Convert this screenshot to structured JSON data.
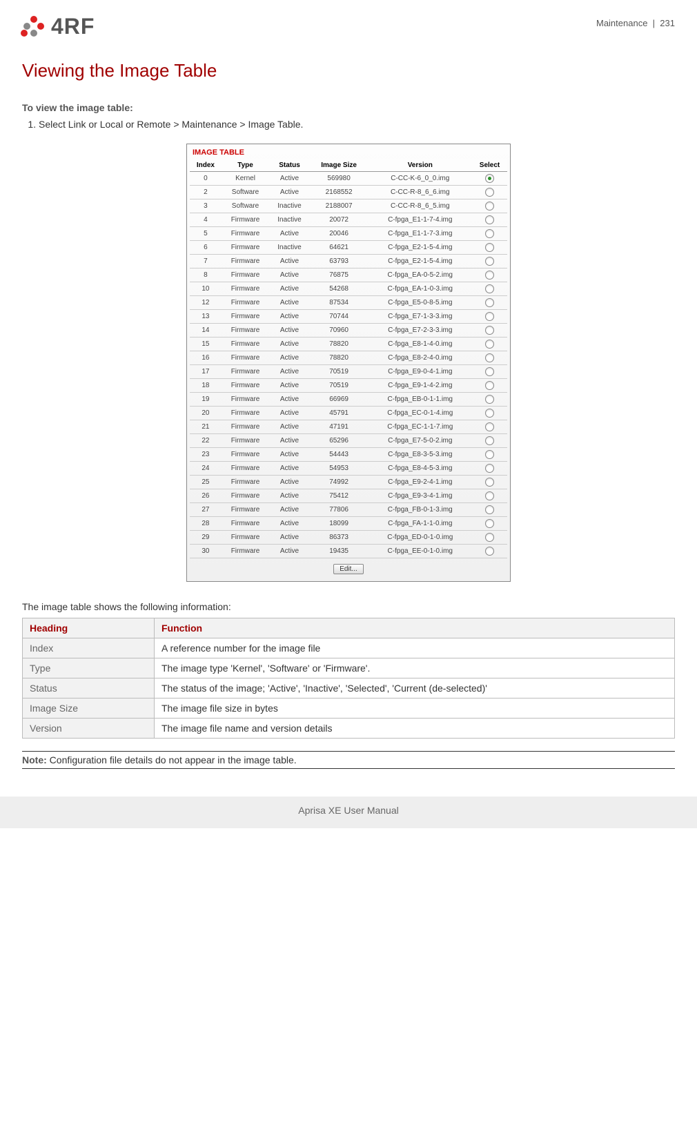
{
  "header": {
    "logo_text": "4RF",
    "section": "Maintenance",
    "separator": "|",
    "page_num": "231"
  },
  "title": "Viewing the Image Table",
  "intro": "To view the image table:",
  "step_number": "1.",
  "step_text": "Select Link or Local or Remote > Maintenance > Image Table.",
  "screenshot": {
    "panel_title": "IMAGE TABLE",
    "headers": [
      "Index",
      "Type",
      "Status",
      "Image Size",
      "Version",
      "Select"
    ],
    "rows": [
      {
        "index": "0",
        "type": "Kernel",
        "status": "Active",
        "size": "569980",
        "version": "C-CC-K-6_0_0.img",
        "selected": true
      },
      {
        "index": "2",
        "type": "Software",
        "status": "Active",
        "size": "2168552",
        "version": "C-CC-R-8_6_6.img",
        "selected": false
      },
      {
        "index": "3",
        "type": "Software",
        "status": "Inactive",
        "size": "2188007",
        "version": "C-CC-R-8_6_5.img",
        "selected": false
      },
      {
        "index": "4",
        "type": "Firmware",
        "status": "Inactive",
        "size": "20072",
        "version": "C-fpga_E1-1-7-4.img",
        "selected": false
      },
      {
        "index": "5",
        "type": "Firmware",
        "status": "Active",
        "size": "20046",
        "version": "C-fpga_E1-1-7-3.img",
        "selected": false
      },
      {
        "index": "6",
        "type": "Firmware",
        "status": "Inactive",
        "size": "64621",
        "version": "C-fpga_E2-1-5-4.img",
        "selected": false
      },
      {
        "index": "7",
        "type": "Firmware",
        "status": "Active",
        "size": "63793",
        "version": "C-fpga_E2-1-5-4.img",
        "selected": false
      },
      {
        "index": "8",
        "type": "Firmware",
        "status": "Active",
        "size": "76875",
        "version": "C-fpga_EA-0-5-2.img",
        "selected": false
      },
      {
        "index": "10",
        "type": "Firmware",
        "status": "Active",
        "size": "54268",
        "version": "C-fpga_EA-1-0-3.img",
        "selected": false
      },
      {
        "index": "12",
        "type": "Firmware",
        "status": "Active",
        "size": "87534",
        "version": "C-fpga_E5-0-8-5.img",
        "selected": false
      },
      {
        "index": "13",
        "type": "Firmware",
        "status": "Active",
        "size": "70744",
        "version": "C-fpga_E7-1-3-3.img",
        "selected": false
      },
      {
        "index": "14",
        "type": "Firmware",
        "status": "Active",
        "size": "70960",
        "version": "C-fpga_E7-2-3-3.img",
        "selected": false
      },
      {
        "index": "15",
        "type": "Firmware",
        "status": "Active",
        "size": "78820",
        "version": "C-fpga_E8-1-4-0.img",
        "selected": false
      },
      {
        "index": "16",
        "type": "Firmware",
        "status": "Active",
        "size": "78820",
        "version": "C-fpga_E8-2-4-0.img",
        "selected": false
      },
      {
        "index": "17",
        "type": "Firmware",
        "status": "Active",
        "size": "70519",
        "version": "C-fpga_E9-0-4-1.img",
        "selected": false
      },
      {
        "index": "18",
        "type": "Firmware",
        "status": "Active",
        "size": "70519",
        "version": "C-fpga_E9-1-4-2.img",
        "selected": false
      },
      {
        "index": "19",
        "type": "Firmware",
        "status": "Active",
        "size": "66969",
        "version": "C-fpga_EB-0-1-1.img",
        "selected": false
      },
      {
        "index": "20",
        "type": "Firmware",
        "status": "Active",
        "size": "45791",
        "version": "C-fpga_EC-0-1-4.img",
        "selected": false
      },
      {
        "index": "21",
        "type": "Firmware",
        "status": "Active",
        "size": "47191",
        "version": "C-fpga_EC-1-1-7.img",
        "selected": false
      },
      {
        "index": "22",
        "type": "Firmware",
        "status": "Active",
        "size": "65296",
        "version": "C-fpga_E7-5-0-2.img",
        "selected": false
      },
      {
        "index": "23",
        "type": "Firmware",
        "status": "Active",
        "size": "54443",
        "version": "C-fpga_E8-3-5-3.img",
        "selected": false
      },
      {
        "index": "24",
        "type": "Firmware",
        "status": "Active",
        "size": "54953",
        "version": "C-fpga_E8-4-5-3.img",
        "selected": false
      },
      {
        "index": "25",
        "type": "Firmware",
        "status": "Active",
        "size": "74992",
        "version": "C-fpga_E9-2-4-1.img",
        "selected": false
      },
      {
        "index": "26",
        "type": "Firmware",
        "status": "Active",
        "size": "75412",
        "version": "C-fpga_E9-3-4-1.img",
        "selected": false
      },
      {
        "index": "27",
        "type": "Firmware",
        "status": "Active",
        "size": "77806",
        "version": "C-fpga_FB-0-1-3.img",
        "selected": false
      },
      {
        "index": "28",
        "type": "Firmware",
        "status": "Active",
        "size": "18099",
        "version": "C-fpga_FA-1-1-0.img",
        "selected": false
      },
      {
        "index": "29",
        "type": "Firmware",
        "status": "Active",
        "size": "86373",
        "version": "C-fpga_ED-0-1-0.img",
        "selected": false
      },
      {
        "index": "30",
        "type": "Firmware",
        "status": "Active",
        "size": "19435",
        "version": "C-fpga_EE-0-1-0.img",
        "selected": false
      }
    ],
    "edit_label": "Edit..."
  },
  "desc_intro": "The image table shows the following information:",
  "desc_table": {
    "headers": [
      "Heading",
      "Function"
    ],
    "rows": [
      {
        "h": "Index",
        "f": "A reference number for the image file"
      },
      {
        "h": "Type",
        "f": "The image type 'Kernel', 'Software' or 'Firmware'."
      },
      {
        "h": "Status",
        "f": "The status of the image; 'Active', 'Inactive', 'Selected', 'Current (de-selected)'"
      },
      {
        "h": "Image Size",
        "f": "The image file size in bytes"
      },
      {
        "h": "Version",
        "f": "The image file name and version details"
      }
    ]
  },
  "note_label": "Note:",
  "note_text": " Configuration file details do not appear in the image table.",
  "footer": "Aprisa XE User Manual"
}
